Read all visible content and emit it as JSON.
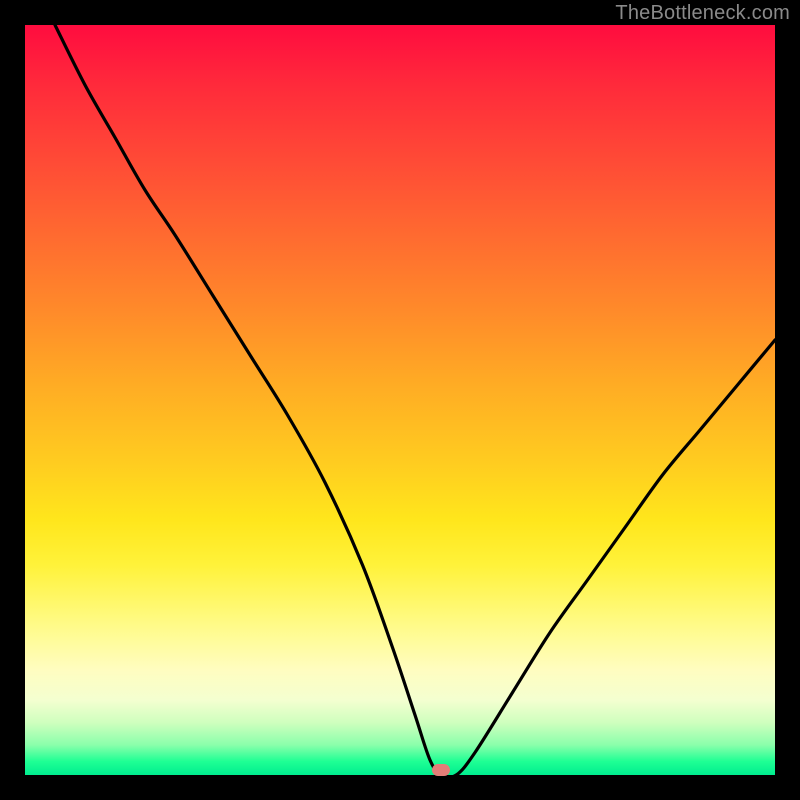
{
  "watermark": "TheBottleneck.com",
  "marker": {
    "x_percent": 55.5,
    "y_percent": 99.3
  },
  "chart_data": {
    "type": "line",
    "title": "",
    "xlabel": "",
    "ylabel": "",
    "xlim": [
      0,
      100
    ],
    "ylim": [
      0,
      100
    ],
    "gradient_bands_top_to_bottom": [
      "red",
      "orange",
      "yellow",
      "pale-yellow",
      "green"
    ],
    "series": [
      {
        "name": "bottleneck-curve",
        "x": [
          4,
          8,
          12,
          16,
          20,
          25,
          30,
          35,
          40,
          45,
          49,
          52,
          54,
          55.5,
          57.5,
          60,
          65,
          70,
          75,
          80,
          85,
          90,
          95,
          100
        ],
        "y": [
          100,
          92,
          85,
          78,
          72,
          64,
          56,
          48,
          39,
          28,
          17,
          8,
          2,
          0,
          0,
          3,
          11,
          19,
          26,
          33,
          40,
          46,
          52,
          58
        ]
      }
    ],
    "marker_point": {
      "x": 55.5,
      "y": 0,
      "color": "#e47d78"
    }
  }
}
